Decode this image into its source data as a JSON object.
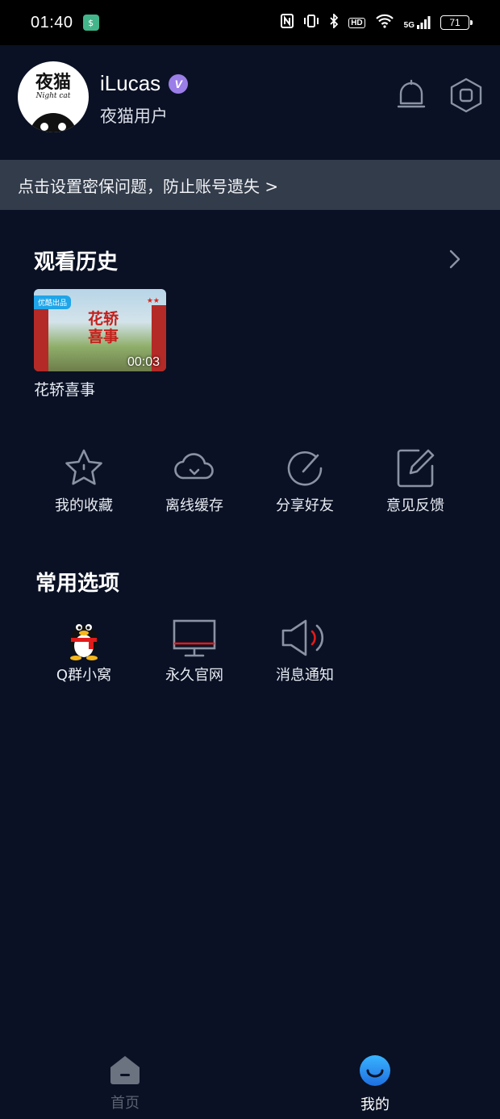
{
  "status_bar": {
    "time": "01:40",
    "battery": "71",
    "network": "5G",
    "hd": "HD"
  },
  "profile": {
    "avatar_brand": "夜猫",
    "avatar_brand_sub": "Night cat",
    "username": "iLucas",
    "vip_badge": "V",
    "role": "夜猫用户"
  },
  "security_banner": {
    "text": "点击设置密保问题，防止账号遗失 >"
  },
  "history": {
    "title": "观看历史",
    "items": [
      {
        "title": "花轿喜事",
        "duration": "00:03",
        "tag": "优酷出品",
        "poster_text": "花轿喜事"
      }
    ]
  },
  "quick_actions": [
    {
      "label": "我的收藏",
      "icon": "star-icon"
    },
    {
      "label": "离线缓存",
      "icon": "cloud-download-icon"
    },
    {
      "label": "分享好友",
      "icon": "share-icon"
    },
    {
      "label": "意见反馈",
      "icon": "edit-feedback-icon"
    }
  ],
  "common_options": {
    "title": "常用选项",
    "items": [
      {
        "label": "Q群小窝",
        "icon": "qq-penguin-icon"
      },
      {
        "label": "永久官网",
        "icon": "monitor-icon"
      },
      {
        "label": "消息通知",
        "icon": "speaker-icon"
      }
    ]
  },
  "bottom_nav": {
    "items": [
      {
        "label": "首页",
        "icon": "home-icon",
        "active": false
      },
      {
        "label": "我的",
        "icon": "profile-smile-icon",
        "active": true
      }
    ]
  },
  "colors": {
    "background": "#0a1124",
    "banner": "#333c4a",
    "accent": "#2a9af0",
    "vip": "#9b7ee8"
  }
}
